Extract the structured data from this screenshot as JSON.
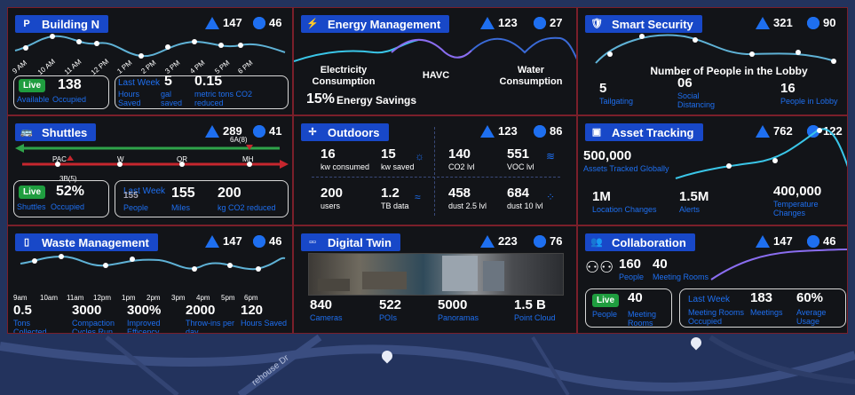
{
  "colors": {
    "accent": "#1e6ff0",
    "header": "#1848c8",
    "live": "#1f9d3f",
    "panel": "#121418",
    "border": "#7a1f2a",
    "map": "#23335d"
  },
  "map": {
    "street_label": "rehouse Dr"
  },
  "building": {
    "title": "Building N",
    "icon": "p-icon",
    "alerts": "147",
    "settings": "46",
    "times": [
      "9 AM",
      "10 AM",
      "11 AM",
      "12 PM",
      "1 PM",
      "2 PM",
      "3 PM",
      "4 PM",
      "5 PM",
      "6 PM"
    ],
    "live": "Live",
    "live_value": "138",
    "live_label_a": "Available",
    "live_label_b": "Occupied",
    "last_week": "Last Week",
    "hours_value": "5",
    "hours_label": "Hours Saved",
    "gal_label": "gal saved",
    "co2_value": "0.15",
    "co2_label": "metric tons CO2 reduced"
  },
  "energy": {
    "title": "Energy Management",
    "alerts": "123",
    "settings": "27",
    "electricity": "Electricity Consumption",
    "havc": "HAVC",
    "water": "Water Consumption",
    "savings_pct": "15%",
    "savings_label": "Energy Savings"
  },
  "security": {
    "title": "Smart Security",
    "alerts": "321",
    "settings": "90",
    "lobby_title": "Number of People in the Lobby",
    "tailgating_value": "5",
    "tailgating_label": "Tailgating",
    "social_value": "06",
    "social_label": "Social Distancing",
    "lobby_value": "16",
    "lobby_label": "People in Lobby"
  },
  "shuttles": {
    "title": "Shuttles",
    "alerts": "289",
    "settings": "41",
    "stops": [
      "PAC",
      "W",
      "QR",
      "MH"
    ],
    "top_label": "6A(8)",
    "bottom_label": "3B(5)",
    "live": "Live",
    "live_value": "52%",
    "live_label_a": "Shuttles",
    "live_label_b": "Occupied",
    "last_week": "Last Week",
    "people_value": "155",
    "people_label": "People",
    "miles_value": "155",
    "miles_label": "Miles",
    "co2_value": "200",
    "co2_label": "kg CO2 reduced"
  },
  "outdoors": {
    "title": "Outdoors",
    "alerts": "123",
    "settings": "86",
    "kw_consumed": "16",
    "kw_consumed_label": "kw consumed",
    "kw_saved": "15",
    "kw_saved_label": "kw saved",
    "co2": "140",
    "co2_label": "CO2 lvl",
    "voc": "551",
    "voc_label": "VOC lvl",
    "users": "200",
    "users_label": "users",
    "tb": "1.2",
    "tb_label": "TB data",
    "dust25": "458",
    "dust25_label": "dust 2.5 lvl",
    "dust10": "684",
    "dust10_label": "dust 10 lvl"
  },
  "asset": {
    "title": "Asset Tracking",
    "alerts": "762",
    "settings": "122",
    "tracked_value": "500,000",
    "tracked_label": "Assets Tracked Globally",
    "loc_value": "1M",
    "loc_label": "Location Changes",
    "alerts_value": "1.5M",
    "alerts_label": "Alerts",
    "temp_value": "400,000",
    "temp_label": "Temperature Changes"
  },
  "waste": {
    "title": "Waste Management",
    "alerts": "147",
    "settings": "46",
    "times": [
      "9am",
      "10am",
      "11am",
      "12pm",
      "1pm",
      "2pm",
      "3pm",
      "4pm",
      "5pm",
      "6pm"
    ],
    "tons_value": "0.5",
    "tons_label": "Tons Collected",
    "comp_value": "3000",
    "comp_label": "Compaction Cycles Run",
    "eff_value": "300%",
    "eff_label": "Improved Efficency",
    "throw_value": "2000",
    "throw_label": "Throw-ins per day",
    "hours_value": "120",
    "hours_label": "Hours Saved"
  },
  "twin": {
    "title": "Digital Twin",
    "alerts": "223",
    "settings": "76",
    "cameras_value": "840",
    "cameras_label": "Cameras",
    "pois_value": "522",
    "pois_label": "POIs",
    "pano_value": "5000",
    "pano_label": "Panoramas",
    "cloud_value": "1.5 B",
    "cloud_label": "Point Cloud"
  },
  "collab": {
    "title": "Collaboration",
    "alerts": "147",
    "settings": "46",
    "people_value": "160",
    "people_label": "People",
    "rooms_value": "40",
    "rooms_label": "Meeting Rooms",
    "live": "Live",
    "live_value": "40",
    "live_label_a": "People",
    "live_label_b": "Meeting Rooms",
    "last_week": "Last Week",
    "occ_value": "183",
    "occ_label": "Meeting Rooms Occupied",
    "meet_label": "Meetings",
    "usage_value": "60%",
    "usage_label": "Average Usage"
  }
}
